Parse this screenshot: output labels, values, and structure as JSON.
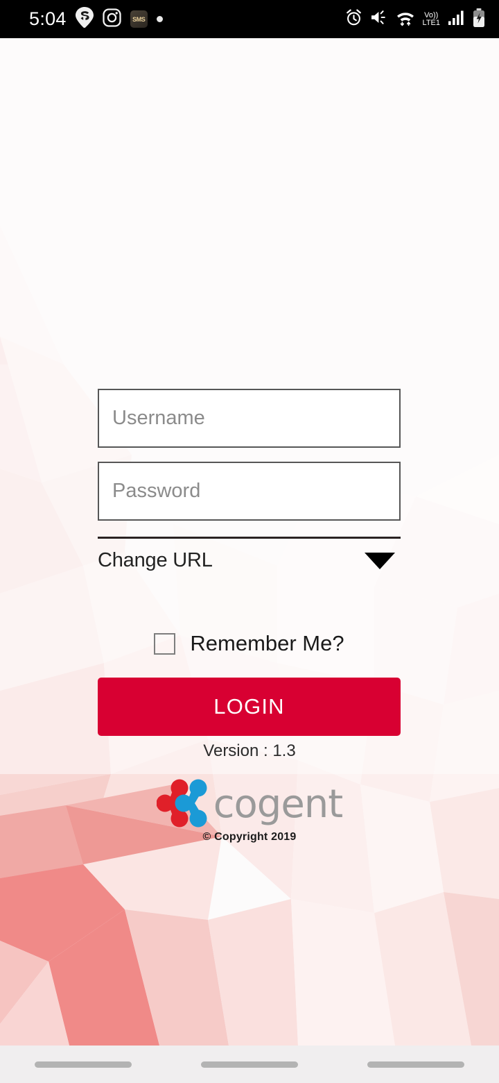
{
  "status_bar": {
    "time": "5:04",
    "left_icons": [
      {
        "name": "swiggy-icon",
        "label": "Swiggy"
      },
      {
        "name": "instagram-icon",
        "label": "Instagram"
      },
      {
        "name": "sms-app-icon",
        "label": "SMS"
      },
      {
        "name": "notification-dot-icon",
        "label": "notification"
      }
    ],
    "sms_badge_text": "SMS",
    "right_icons": [
      {
        "name": "alarm-clock-icon",
        "label": "Alarm"
      },
      {
        "name": "vibrate-icon",
        "label": "Vibrate"
      },
      {
        "name": "wifi-data-icon",
        "label": "Wi-Fi"
      },
      {
        "name": "signal-bars-icon",
        "label": "Signal"
      },
      {
        "name": "battery-charging-icon",
        "label": "Charging"
      }
    ],
    "volte_top": "Vo))",
    "volte_bottom": "LTE1"
  },
  "form": {
    "username_placeholder": "Username",
    "username_value": "",
    "password_placeholder": "Password",
    "password_value": "",
    "change_url_label": "Change URL",
    "remember_label": "Remember Me?",
    "remember_checked": false,
    "login_label": "LOGIN"
  },
  "footer": {
    "version_text": "Version : 1.3",
    "wordmark": "cogent",
    "copyright": "© Copyright 2019"
  },
  "nav_bar": {
    "pills": [
      "recents-pill",
      "home-pill",
      "back-pill"
    ]
  },
  "colors": {
    "accent_red": "#d80032",
    "logo_red": "#e02029",
    "logo_blue": "#1b9ad6",
    "wordmark_gray": "#9a9a9a",
    "bg_pink_strong": "#f08a88",
    "bg_pink_soft": "#f7d4d2",
    "status_bar_bg": "#000000",
    "nav_bar_bg": "#f0eeef"
  }
}
